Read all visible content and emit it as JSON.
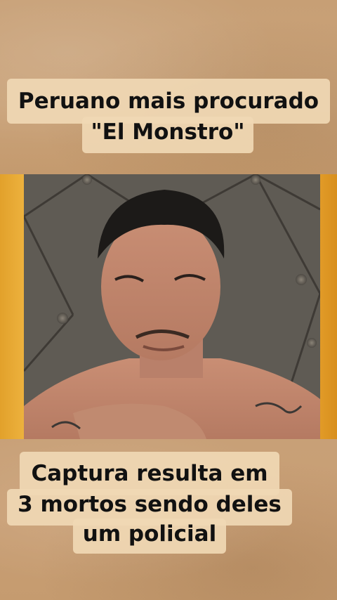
{
  "headline": {
    "line1": "Peruano mais procurado",
    "line2": "\"El Monstro\""
  },
  "caption": {
    "line1": "Captura resulta em",
    "line2": "3 mortos sendo deles",
    "line3": "um policial"
  },
  "colors": {
    "background": "#c9a27a",
    "frame_gold": "#f1b845",
    "caption_box": "#f0d8b4",
    "text": "#111111"
  }
}
